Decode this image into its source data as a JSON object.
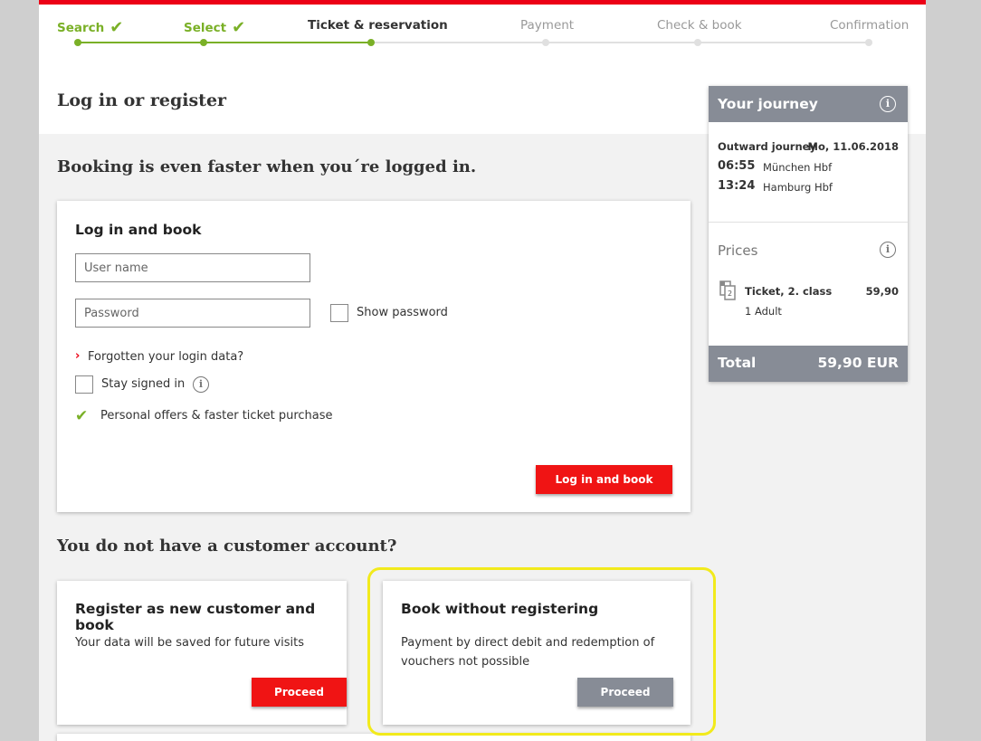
{
  "progress": {
    "steps": [
      {
        "label": "Search",
        "state": "done"
      },
      {
        "label": "Select",
        "state": "done"
      },
      {
        "label": "Ticket & reservation",
        "state": "active"
      },
      {
        "label": "Payment",
        "state": "todo"
      },
      {
        "label": "Check & book",
        "state": "todo"
      },
      {
        "label": "Confirmation",
        "state": "todo"
      }
    ]
  },
  "page_title": "Log in or register",
  "login_intro": "Booking is even faster when you´re logged in.",
  "login_card": {
    "title": "Log in and book",
    "username_placeholder": "User name",
    "password_placeholder": "Password",
    "show_password_label": "Show password",
    "forgot_link": "Forgotten your login data?",
    "stay_signed_in_label": "Stay signed in",
    "benefit_text": "Personal offers & faster ticket purchase",
    "submit_label": "Log in and book"
  },
  "no_account_heading": "You do not have a customer account?",
  "register_card": {
    "title": "Register as new customer and book",
    "text": "Your data will be saved for future visits",
    "button_label": "Proceed"
  },
  "guest_card": {
    "title": "Book without registering",
    "text": "Payment by direct debit and redemption of vouchers not possible",
    "button_label": "Proceed"
  },
  "journey": {
    "title": "Your journey",
    "outward_label": "Outward journey",
    "date": "Mo, 11.06.2018",
    "departure_time": "06:55",
    "departure_station": "München Hbf",
    "arrival_time": "13:24",
    "arrival_station": "Hamburg Hbf",
    "prices_title": "Prices",
    "ticket_label": "Ticket, 2. class",
    "ticket_price": "59,90",
    "passengers": "1 Adult",
    "ticket_icon_badge": "2",
    "total_label": "Total",
    "total_value": "59,90 EUR"
  },
  "icons": {
    "step_done": "checkmark-icon",
    "info": "info-icon",
    "forgot": "chevron-right-icon",
    "benefit": "checkmark-icon",
    "ticket": "ticket-icon"
  },
  "colors": {
    "brand_red": "#ec0016",
    "button_red": "#f01414",
    "progress_green": "#7ab027",
    "neutral_grey": "#878c96",
    "highlight_yellow": "#f2ea1c"
  }
}
